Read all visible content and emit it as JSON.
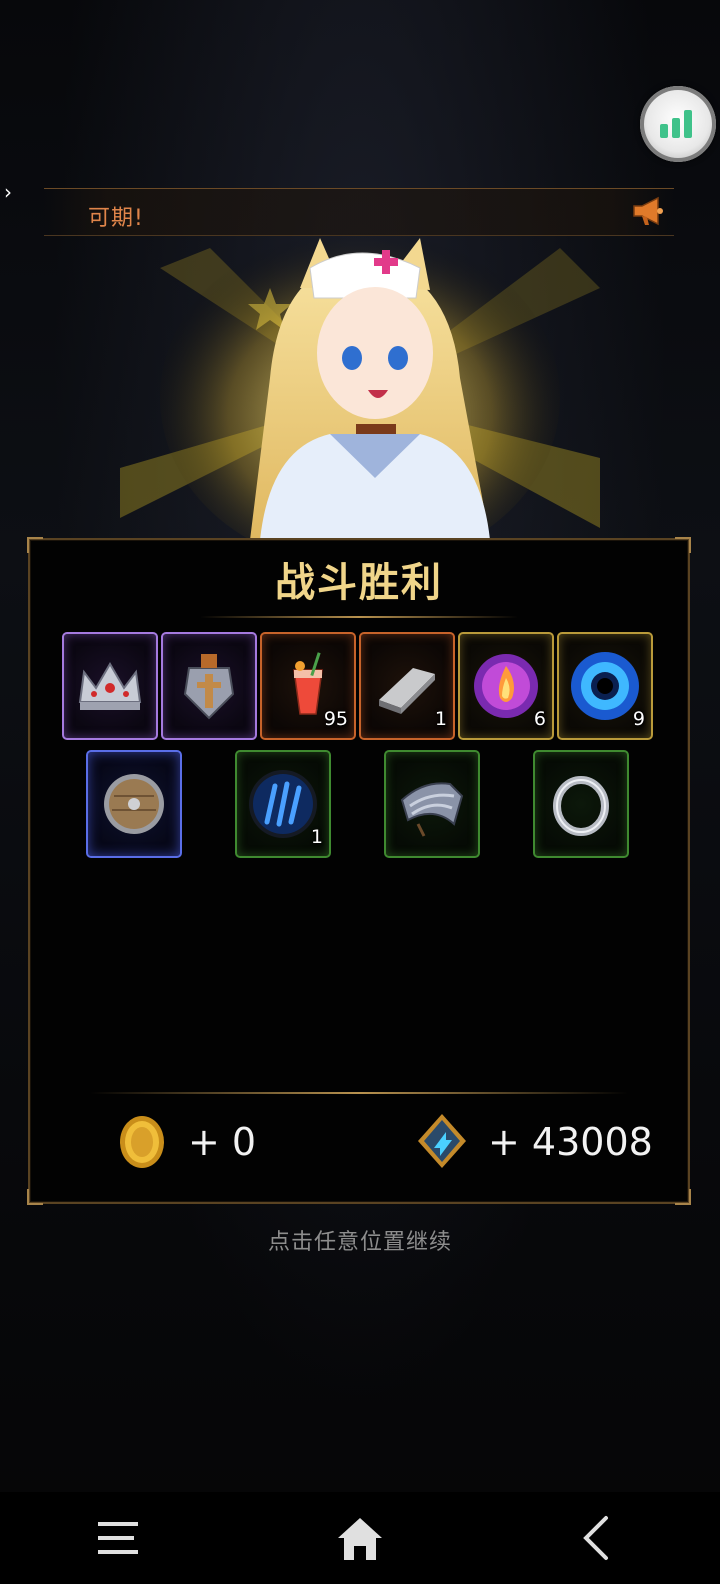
{
  "marquee": {
    "text": "可期!"
  },
  "result": {
    "title": "战斗胜利"
  },
  "rewards_row1": [
    {
      "icon": "crown-icon",
      "rarity": "purple",
      "count": ""
    },
    {
      "icon": "shield-amulet-icon",
      "rarity": "purple",
      "count": ""
    },
    {
      "icon": "red-drink-icon",
      "rarity": "orange",
      "count": "95"
    },
    {
      "icon": "iron-ingot-icon",
      "rarity": "orange",
      "count": "1"
    },
    {
      "icon": "fire-orb-icon",
      "rarity": "gold",
      "count": "6"
    },
    {
      "icon": "blue-portal-icon",
      "rarity": "gold",
      "count": "9"
    }
  ],
  "rewards_row2": [
    {
      "icon": "wooden-shield-icon",
      "rarity": "blue",
      "count": ""
    },
    {
      "icon": "claw-rune-icon",
      "rarity": "green",
      "count": "1"
    },
    {
      "icon": "shoulder-armor-icon",
      "rarity": "green",
      "count": ""
    },
    {
      "icon": "silver-ring-icon",
      "rarity": "green",
      "count": ""
    }
  ],
  "currency": {
    "gold": "+ 0",
    "exp": "+ 43008"
  },
  "hint": "点击任意位置继续",
  "colors": {
    "title": "#f0d58a",
    "marquee": "#e0854a",
    "panel_border": "#5a4322"
  }
}
